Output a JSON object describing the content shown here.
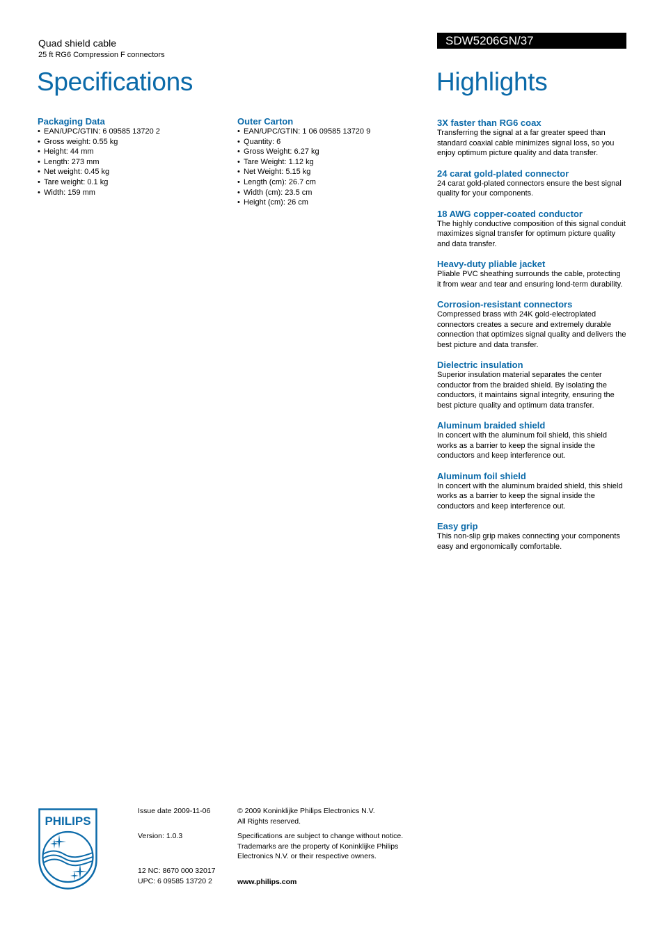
{
  "header": {
    "product_name": "Quad shield cable",
    "product_subtitle": "25 ft RG6 Compression F connectors",
    "model_number": "SDW5206GN/37"
  },
  "specifications": {
    "title": "Specifications",
    "sections": [
      {
        "heading": "Packaging Data",
        "items": [
          "EAN/UPC/GTIN: 6 09585 13720 2",
          "Gross weight: 0.55 kg",
          "Height: 44 mm",
          "Length: 273 mm",
          "Net weight: 0.45 kg",
          "Tare weight: 0.1 kg",
          "Width: 159 mm"
        ]
      },
      {
        "heading": "Outer Carton",
        "items": [
          "EAN/UPC/GTIN: 1 06 09585 13720 9",
          "Quantity: 6",
          "Gross Weight: 6.27 kg",
          "Tare Weight: 1.12 kg",
          "Net Weight: 5.15 kg",
          "Length (cm): 26.7 cm",
          "Width (cm): 23.5 cm",
          "Height (cm): 26 cm"
        ]
      }
    ]
  },
  "highlights": {
    "title": "Highlights",
    "items": [
      {
        "heading": "3X faster than RG6 coax",
        "text": "Transferring the signal at a far greater speed than standard coaxial cable minimizes signal loss, so you enjoy optimum picture quality and data transfer."
      },
      {
        "heading": "24 carat gold-plated connector",
        "text": "24 carat gold-plated connectors ensure the best signal quality for your components."
      },
      {
        "heading": "18 AWG copper-coated conductor",
        "text": "The highly conductive composition of this signal conduit maximizes signal transfer for optimum picture quality and data transfer."
      },
      {
        "heading": "Heavy-duty pliable jacket",
        "text": "Pliable PVC sheathing surrounds the cable, protecting it from wear and tear and ensuring lond-term durability."
      },
      {
        "heading": "Corrosion-resistant connectors",
        "text": "Compressed brass with 24K gold-electroplated connectors creates a secure and extremely durable connection that optimizes signal quality and delivers the best picture and data transfer."
      },
      {
        "heading": "Dielectric insulation",
        "text": "Superior insulation material separates the center conductor from the braided shield. By isolating the conductors, it maintains signal integrity, ensuring the best picture quality and optimum data transfer."
      },
      {
        "heading": "Aluminum braided shield",
        "text": "In concert with the aluminum foil shield, this shield works as a barrier to keep the signal inside the conductors and keep interference out."
      },
      {
        "heading": "Aluminum foil shield",
        "text": "In concert with the aluminum braided shield, this shield works as a barrier to keep the signal inside the conductors and keep interference out."
      },
      {
        "heading": "Easy grip",
        "text": "This non-slip grip makes connecting your components easy and ergonomically comfortable."
      }
    ]
  },
  "footer": {
    "logo_text": "PHILIPS",
    "logo_icon": "philips-shield-logo",
    "issue_date": "Issue date 2009-11-06",
    "version": "Version: 1.0.3",
    "nc": "12 NC: 8670 000 32017",
    "upc": "UPC: 6 09585 13720 2",
    "copyright_line1": "© 2009 Koninklijke Philips Electronics N.V.",
    "copyright_line2": "All Rights reserved.",
    "disclaimer_line1": "Specifications are subject to change without notice.",
    "disclaimer_line2": "Trademarks are the property of Koninklijke Philips",
    "disclaimer_line3": "Electronics N.V. or their respective owners.",
    "website": "www.philips.com"
  },
  "colors": {
    "brand_blue": "#0b6aa9",
    "model_bar_bg": "#000000",
    "model_bar_text": "#ffffff"
  }
}
